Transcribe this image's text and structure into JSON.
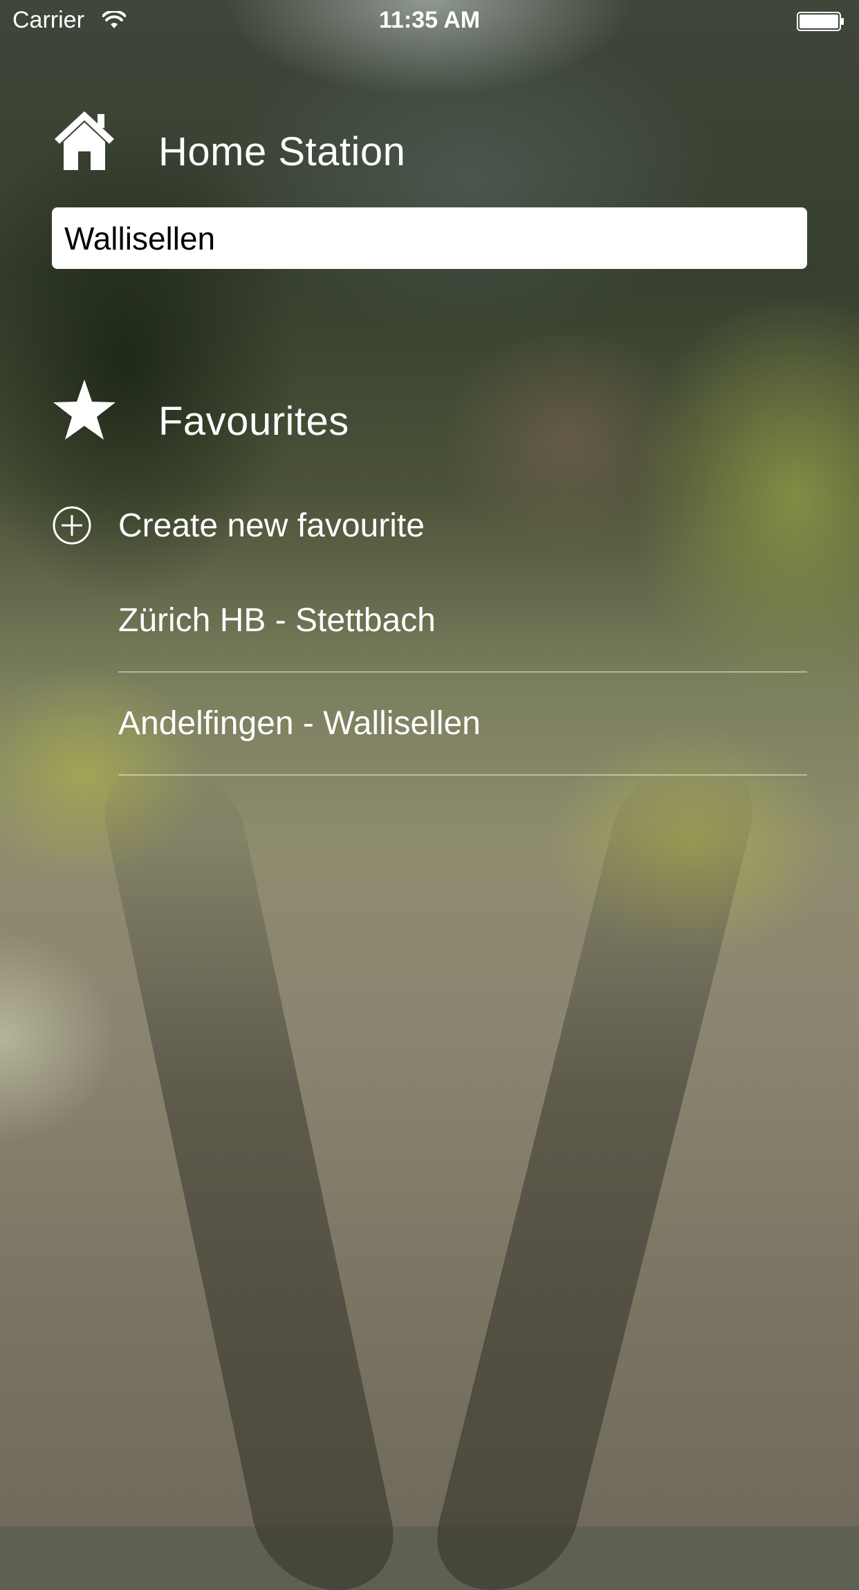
{
  "status_bar": {
    "carrier": "Carrier",
    "time": "11:35 AM",
    "icons": [
      "wifi-icon",
      "battery-icon"
    ]
  },
  "home_station": {
    "icon": "home-icon",
    "title": "Home Station",
    "input_value": "Wallisellen"
  },
  "favourites": {
    "icon": "star-icon",
    "title": "Favourites",
    "create_icon": "plus-circle-icon",
    "create_label": "Create new favourite",
    "items": [
      {
        "label": "Zürich HB - Stettbach"
      },
      {
        "label": "Andelfingen - Wallisellen"
      }
    ]
  },
  "colors": {
    "text": "#ffffff",
    "input_background": "#ffffff",
    "input_text": "#000000",
    "separator": "rgba(255,255,255,0.45)"
  }
}
